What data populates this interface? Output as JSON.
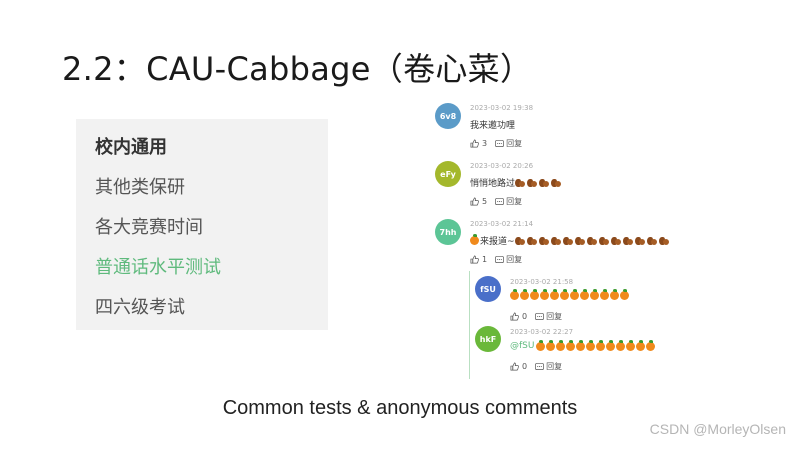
{
  "title": "2.2：CAU-Cabbage（卷心菜）",
  "categories": [
    {
      "label": "校内通用",
      "style": "bold"
    },
    {
      "label": "其他类保研",
      "style": "normal"
    },
    {
      "label": "各大竞赛时间",
      "style": "normal"
    },
    {
      "label": "普通话水平测试",
      "style": "active"
    },
    {
      "label": "四六级考试",
      "style": "normal"
    }
  ],
  "comments": [
    {
      "avatar": "6v8",
      "avatar_color": "#5b9bc8",
      "time": "2023-03-02 19:38",
      "text": "我来邀功哩",
      "emoji": "",
      "emoji_count": 0,
      "likes": "3",
      "reply": "回复"
    },
    {
      "avatar": "eFy",
      "avatar_color": "#a4b82c",
      "time": "2023-03-02 20:26",
      "text": "悄悄地路过",
      "emoji": "squirrel",
      "emoji_count": 4,
      "likes": "5",
      "reply": "回复"
    },
    {
      "avatar": "7hh",
      "avatar_color": "#5cc596",
      "time": "2023-03-02 21:14",
      "text": "来报道~",
      "emoji": "squirrel",
      "emoji_count": 13,
      "lead_emoji": "tangerine",
      "likes": "1",
      "reply": "回复"
    }
  ],
  "replies": [
    {
      "avatar": "fSU",
      "avatar_color": "#4a6fc9",
      "time": "2023-03-02 21:58",
      "mention": "",
      "emoji": "tangerine",
      "emoji_count": 12,
      "likes": "0",
      "reply": "回复"
    },
    {
      "avatar": "hkF",
      "avatar_color": "#6ab83a",
      "time": "2023-03-02 22:27",
      "mention": "@fSU",
      "emoji": "tangerine",
      "emoji_count": 12,
      "likes": "0",
      "reply": "回复"
    }
  ],
  "caption": "Common tests & anonymous comments",
  "watermark": "CSDN @MorleyOlsen"
}
